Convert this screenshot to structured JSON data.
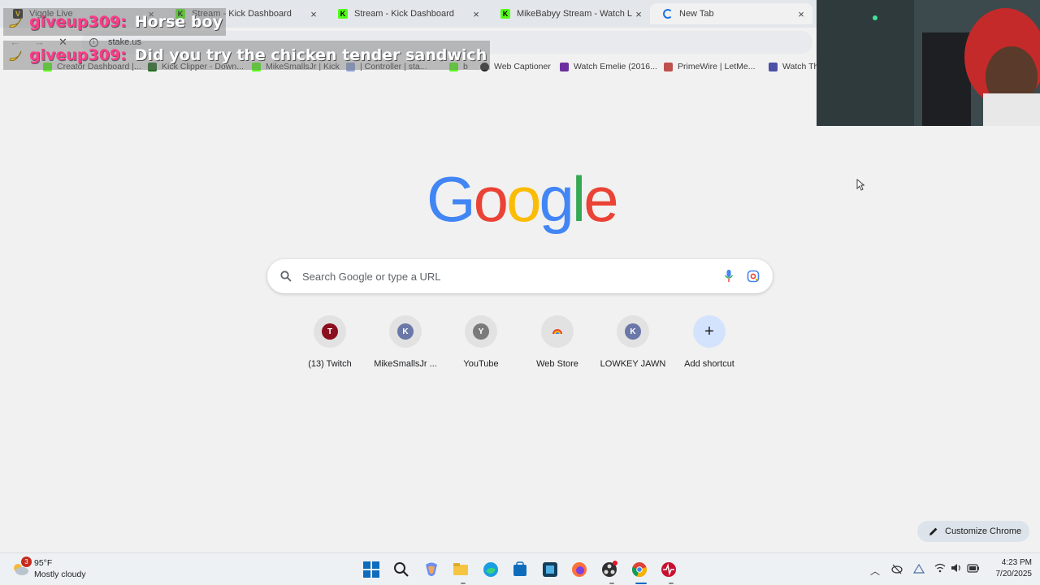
{
  "browser": {
    "tabs": [
      {
        "title": "Viggle Live",
        "favicon": "viggle-icon",
        "close": "×"
      },
      {
        "title": "Stream - Kick Dashboard",
        "favicon": "kick-icon",
        "close": "×"
      },
      {
        "title": "Stream - Kick Dashboard",
        "favicon": "kick-icon",
        "close": "×"
      },
      {
        "title": "MikeBabyy Stream - Watch Live",
        "favicon": "kick-icon",
        "close": "×"
      },
      {
        "title": "New Tab",
        "favicon": "loading-spinner-icon",
        "close": "×"
      }
    ],
    "nav": {
      "back": "←",
      "forward": "→",
      "stop": "✕"
    },
    "address": "stake.us",
    "bookmarks": [
      "Creator Dashboard |...",
      "Kick Clipper - Down...",
      "MikeSmallsJr | Kick",
      "| Controller | sta...",
      "b",
      "Web Captioner",
      "Watch Emelie (2016...",
      "PrimeWire | LetMe...",
      "Watch Th"
    ]
  },
  "chat": [
    {
      "user": "giveup309:",
      "message": "Horse boy"
    },
    {
      "user": "giveup309:",
      "message": "Did you try the chicken tender sandwich"
    }
  ],
  "google": {
    "logo_letters": [
      {
        "ch": "G",
        "color": "#4285F4"
      },
      {
        "ch": "o",
        "color": "#EA4335"
      },
      {
        "ch": "o",
        "color": "#FBBC05"
      },
      {
        "ch": "g",
        "color": "#4285F4"
      },
      {
        "ch": "l",
        "color": "#34A853"
      },
      {
        "ch": "e",
        "color": "#EA4335"
      }
    ],
    "search_placeholder": "Search Google or type a URL",
    "shortcuts": [
      {
        "label": "(13) Twitch",
        "initial": "T",
        "color": "#8b0f1c"
      },
      {
        "label": "MikeSmallsJr ...",
        "initial": "K",
        "color": "#6a78a8"
      },
      {
        "label": "YouTube",
        "initial": "Y",
        "color": "#7a7a7a"
      },
      {
        "label": "Web Store",
        "initial": "",
        "color": "#e8e8e8"
      },
      {
        "label": "LOWKEY JAWN",
        "initial": "K",
        "color": "#6a78a8"
      },
      {
        "label": "Add shortcut",
        "initial": "+",
        "color": "#d3e3fd"
      }
    ],
    "customize_label": "Customize Chrome"
  },
  "taskbar": {
    "weather_badge": "3",
    "temperature": "95°F",
    "condition": "Mostly cloudy",
    "time": "4:23 PM",
    "date": "7/20/2025"
  }
}
